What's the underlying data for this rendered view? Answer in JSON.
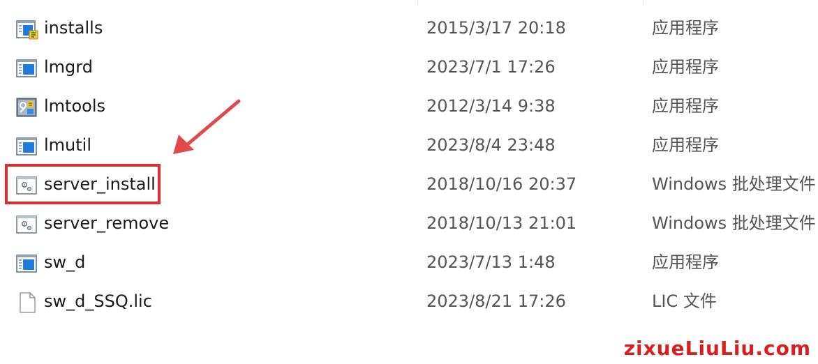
{
  "files": [
    {
      "name": "installs",
      "date": "2015/3/17 20:18",
      "type": "应用程序",
      "icon": "installer-app-icon"
    },
    {
      "name": "lmgrd",
      "date": "2023/7/1 17:26",
      "type": "应用程序",
      "icon": "application-icon"
    },
    {
      "name": "lmtools",
      "date": "2012/3/14 9:38",
      "type": "应用程序",
      "icon": "tools-app-icon"
    },
    {
      "name": "lmutil",
      "date": "2023/8/4 23:48",
      "type": "应用程序",
      "icon": "application-icon"
    },
    {
      "name": "server_install",
      "date": "2018/10/16 20:37",
      "type": "Windows 批处理文件",
      "icon": "batch-file-icon"
    },
    {
      "name": "server_remove",
      "date": "2018/10/13 21:01",
      "type": "Windows 批处理文件",
      "icon": "batch-file-icon"
    },
    {
      "name": "sw_d",
      "date": "2023/7/13 1:48",
      "type": "应用程序",
      "icon": "application-icon"
    },
    {
      "name": "sw_d_SSQ.lic",
      "date": "2023/8/21 17:26",
      "type": "LIC 文件",
      "icon": "generic-file-icon"
    }
  ],
  "annotation": {
    "highlight_color": "#e02f2f",
    "highlighted_file": "server_install"
  },
  "watermark": "zixueLiuLiu.com"
}
